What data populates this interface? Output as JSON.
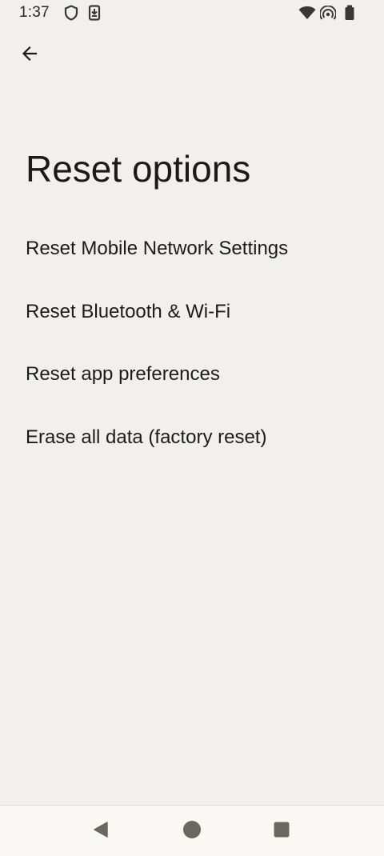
{
  "status_bar": {
    "time": "1:37",
    "icons": [
      "shield-icon",
      "download-icon",
      "wifi-icon",
      "hotspot-icon",
      "battery-icon"
    ]
  },
  "header": {
    "back_icon": "arrow-back-icon"
  },
  "page": {
    "title": "Reset options"
  },
  "options": [
    {
      "label": "Reset Mobile Network Settings"
    },
    {
      "label": "Reset Bluetooth & Wi-Fi"
    },
    {
      "label": "Reset app preferences"
    },
    {
      "label": "Erase all data (factory reset)"
    }
  ],
  "nav_bar": {
    "buttons": [
      "back-triangle-icon",
      "home-circle-icon",
      "recents-square-icon"
    ]
  },
  "colors": {
    "background": "#f1f0ec",
    "text": "#1d1b18",
    "icon": "#3a3834",
    "nav_background": "#f9f8f5"
  }
}
